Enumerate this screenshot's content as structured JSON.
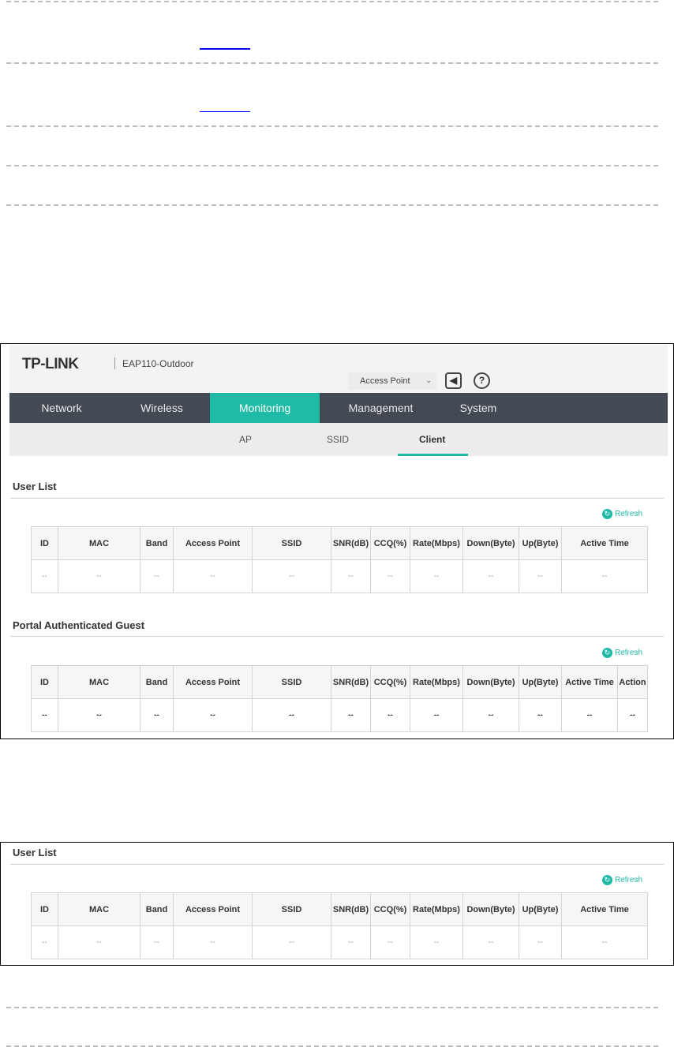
{
  "shot1": {
    "logo": "TP-LINK",
    "model": "EAP110-Outdoor",
    "mode": "Access Point",
    "nav": [
      "Network",
      "Wireless",
      "Monitoring",
      "Management",
      "System"
    ],
    "subtabs": [
      "AP",
      "SSID",
      "Client"
    ],
    "user_list": {
      "title": "User List",
      "refresh": "Refresh",
      "headers": [
        "ID",
        "MAC",
        "Band",
        "Access Point",
        "SSID",
        "SNR(dB)",
        "CCQ(%)",
        "Rate(Mbps)",
        "Down(Byte)",
        "Up(Byte)",
        "Active Time"
      ],
      "row": [
        "--",
        "--",
        "--",
        "--",
        "--",
        "--",
        "--",
        "--",
        "--",
        "--",
        "--"
      ]
    },
    "portal": {
      "title": "Portal Authenticated Guest",
      "refresh": "Refresh",
      "headers": [
        "ID",
        "MAC",
        "Band",
        "Access Point",
        "SSID",
        "SNR(dB)",
        "CCQ(%)",
        "Rate(Mbps)",
        "Down(Byte)",
        "Up(Byte)",
        "Active Time",
        "Action"
      ],
      "row": [
        "--",
        "--",
        "--",
        "--",
        "--",
        "--",
        "--",
        "--",
        "--",
        "--",
        "--",
        "--"
      ]
    }
  },
  "shot2": {
    "user_list": {
      "title": "User List",
      "refresh": "Refresh",
      "headers": [
        "ID",
        "MAC",
        "Band",
        "Access Point",
        "SSID",
        "SNR(dB)",
        "CCQ(%)",
        "Rate(Mbps)",
        "Down(Byte)",
        "Up(Byte)",
        "Active Time"
      ],
      "row": [
        "--",
        "--",
        "--",
        "--",
        "--",
        "--",
        "--",
        "--",
        "--",
        "--",
        "--"
      ]
    }
  },
  "colors": {
    "accent": "#1fbba6",
    "nav": "#434a54"
  }
}
